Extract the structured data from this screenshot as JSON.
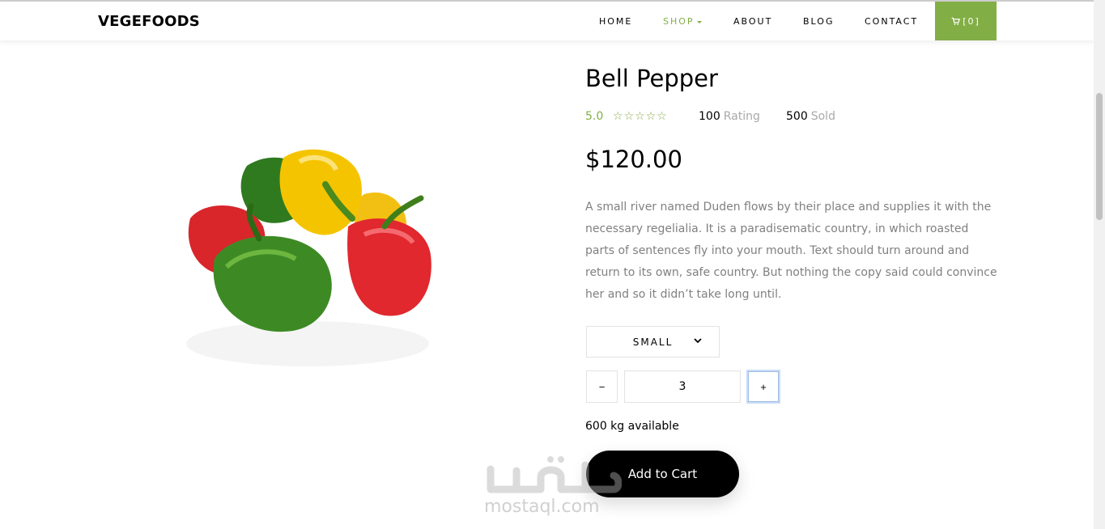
{
  "brand": "VEGEFOODS",
  "nav": {
    "home": "HOME",
    "shop": "SHOP",
    "about": "ABOUT",
    "blog": "BLOG",
    "contact": "CONTACT",
    "cart": "[0]"
  },
  "colors": {
    "accent": "#82ae46",
    "button": "#000000",
    "muted": "#808080"
  },
  "product": {
    "title": "Bell Pepper",
    "rating": "5.0",
    "stars": 5,
    "rating_count": "100",
    "rating_label": "Rating",
    "sold_count": "500",
    "sold_label": "Sold",
    "price": "$120.00",
    "description": "A small river named Duden flows by their place and supplies it with the necessary regelialia. It is a paradisematic country, in which roasted parts of sentences fly into your mouth. Text should turn around and return to its own, safe country. But nothing the copy said could convince her and so it didn’t take long until.",
    "size_selected": "SMALL",
    "qty_minus": "−",
    "qty_value": "3",
    "qty_plus": "+",
    "availability": "600 kg available",
    "add_to_cart": "Add to Cart"
  },
  "watermark": {
    "text": "mostaql.com",
    "logo": "مستقل"
  },
  "icons": {
    "cart": "cart-icon",
    "size_dropdown": "chevron-down-icon",
    "shop_dropdown": "caret-down-icon"
  }
}
